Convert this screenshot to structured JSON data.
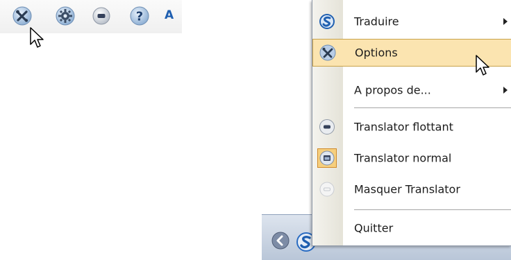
{
  "toolbar": {
    "buttons": [
      {
        "name": "options-icon",
        "icon": "wrench-screwdriver-icon"
      },
      {
        "name": "settings-icon",
        "icon": "gear-icon"
      },
      {
        "name": "minimize-icon",
        "icon": "minus-circle-icon"
      },
      {
        "name": "help-icon",
        "icon": "question-icon"
      }
    ],
    "trailing_letter": "A"
  },
  "menu": {
    "items": [
      {
        "label": "Traduire",
        "icon": "translator-s-icon",
        "submenu": true
      },
      {
        "label": "Options",
        "icon": "wrench-screwdriver-icon",
        "highlighted": true
      },
      {
        "label": "A propos de...",
        "icon": "",
        "submenu": true
      },
      {
        "label": "Translator flottant",
        "icon": "minus-circle-icon"
      },
      {
        "label": "Translator normal",
        "icon": "window-icon",
        "checked": true
      },
      {
        "label": "Masquer Translator",
        "icon": "hidden-circle-icon"
      },
      {
        "label": "Quitter",
        "icon": ""
      }
    ]
  },
  "colors": {
    "highlight": "#fbe4b0",
    "highlight_border": "#c8a24a",
    "accent_blue": "#1f5fb0"
  }
}
